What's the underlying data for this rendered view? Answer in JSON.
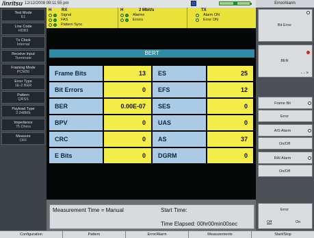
{
  "header": {
    "logo": "/inritsu",
    "datetime": "12/12/2008 09:11:55 pm",
    "right_title": "Error/Alarm"
  },
  "left_menu": [
    {
      "label": "Test Mode",
      "value": "E1"
    },
    {
      "label": "Line Code",
      "value": "HDB3"
    },
    {
      "label": "Tx Clock",
      "value": "Internal"
    },
    {
      "label": "Receive Input",
      "value": "Terminate"
    },
    {
      "label": "Framing Mode",
      "value": "PCM30"
    },
    {
      "label": "Error Type",
      "value": "1E-2 BER"
    },
    {
      "label": "Pattern",
      "value": "QRSS"
    },
    {
      "label": "Payload Type",
      "value": "2.048Mb"
    },
    {
      "label": "Impedance",
      "value": "75 Ohms"
    },
    {
      "label": "Measure",
      "value": "OFF"
    }
  ],
  "status": {
    "rx": {
      "head_h": "H",
      "head_title": "RX",
      "items": [
        "Signal",
        "FAS",
        "Pattern Sync"
      ]
    },
    "alarms": {
      "head_h": "H",
      "head_title": "2 Mbit/s",
      "items": [
        "Alarms",
        "Errors"
      ]
    },
    "tx": {
      "head_title": "TX",
      "items": [
        "Alarm ON",
        "Error ON"
      ]
    }
  },
  "bert": {
    "title": "BERT",
    "rows": [
      {
        "l1": "Frame Bits",
        "v1": "13",
        "l2": "ES",
        "v2": "25"
      },
      {
        "l1": "Bit Errors",
        "v1": "0",
        "l2": "EFS",
        "v2": "12"
      },
      {
        "l1": "BER",
        "v1": "0.00E-07",
        "l2": "SES",
        "v2": "0"
      },
      {
        "l1": "BPV",
        "v1": "0",
        "l2": "UAS",
        "v2": "0"
      },
      {
        "l1": "CRC",
        "v1": "0",
        "l2": "AS",
        "v2": "37"
      },
      {
        "l1": "E Bits",
        "v1": "0",
        "l2": "DGRM",
        "v2": "0"
      }
    ]
  },
  "measurement": {
    "mode": "Measurement Time = Manual",
    "start_time": "Start Time:",
    "elapsed": "Time Elapsed: 00hr00min00sec"
  },
  "right_menu": {
    "bit_error": "Bit Error",
    "ber": "BER",
    "frame_bit": "Frame Bit",
    "error": "Error",
    "ais_alarm": "AIS Alarm",
    "onoff_1": "On/Off",
    "rai_alarm": "RAI Alarm",
    "onoff_2": "On/Off",
    "error_toggle": "Error",
    "off": "Off",
    "on": "On"
  },
  "bottom_tabs": [
    "Configuration",
    "Pattern",
    "Error/Alarm",
    "Measurements",
    "Start/Stop"
  ]
}
